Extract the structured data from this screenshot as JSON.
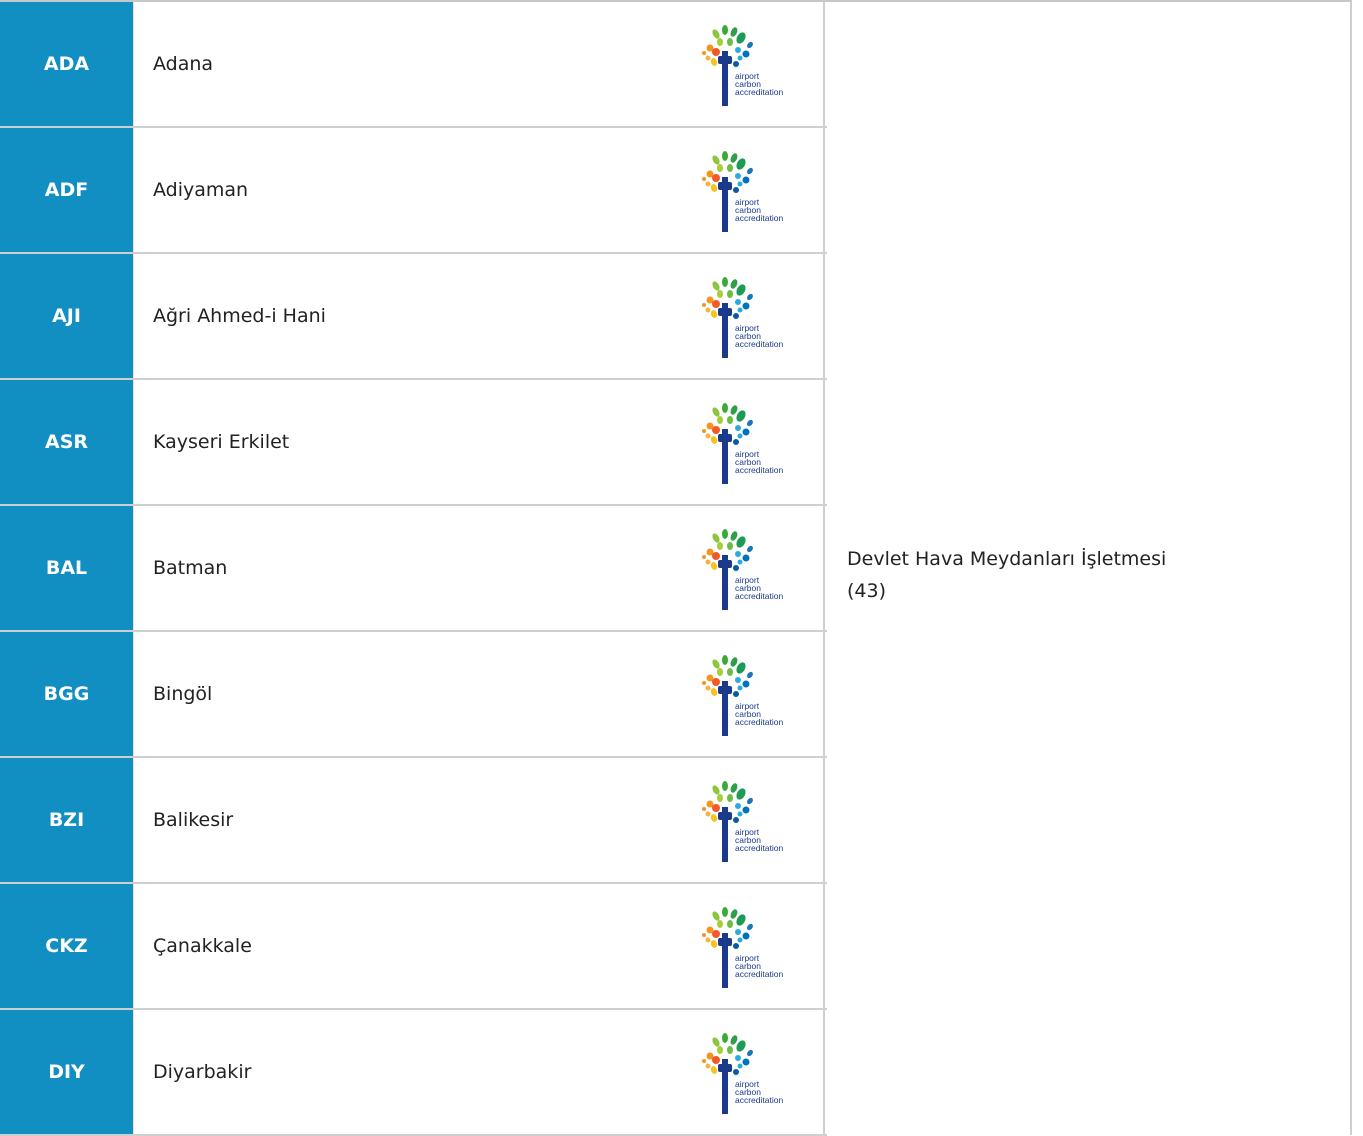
{
  "airports": [
    {
      "code": "ADA",
      "name": "Adana"
    },
    {
      "code": "ADF",
      "name": "Adiyaman"
    },
    {
      "code": "AJI",
      "name": "Ağri Ahmed-i Hani"
    },
    {
      "code": "ASR",
      "name": "Kayseri Erkilet"
    },
    {
      "code": "BAL",
      "name": "Batman"
    },
    {
      "code": "BGG",
      "name": "Bingöl"
    },
    {
      "code": "BZI",
      "name": "Balikesir"
    },
    {
      "code": "CKZ",
      "name": "Çanakkale"
    },
    {
      "code": "DIY",
      "name": "Diyarbakir"
    }
  ],
  "logo": {
    "line1": "airport",
    "line2": "carbon",
    "line3": "accreditation",
    "icon": "airport-carbon-accreditation-tree-icon"
  },
  "operator": {
    "name": "Devlet Hava Meydanları İşletmesi",
    "count": "(43)"
  },
  "colors": {
    "code_cell_bg": "#118fc3",
    "code_text": "#ffffff",
    "border": "#cfcfcf",
    "logo_text": "#1b3a8c"
  }
}
